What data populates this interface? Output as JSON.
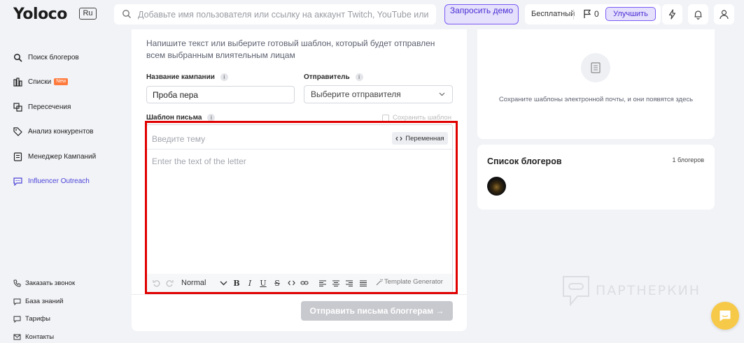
{
  "header": {
    "logo": "Yoloco",
    "lang": "Ru",
    "search_placeholder": "Добавьте имя пользователя или ссылку на аккаунт Twitch, YouTube или Instagram",
    "demo_label": "Запросить демо",
    "plan_label": "Бесплатный",
    "flag_count": "0",
    "upgrade_label": "Улучшить"
  },
  "sidebar": {
    "items": [
      {
        "label": "Поиск блогеров",
        "icon": "search-icon"
      },
      {
        "label": "Списки",
        "icon": "list-icon",
        "badge": "New"
      },
      {
        "label": "Пересечения",
        "icon": "intersection-icon"
      },
      {
        "label": "Анализ конкурентов",
        "icon": "tag-icon"
      },
      {
        "label": "Менеджер Кампаний",
        "icon": "campaign-icon"
      },
      {
        "label": "Influencer Outreach",
        "icon": "chat-icon",
        "active": true
      }
    ],
    "footer": [
      {
        "label": "Заказать звонок",
        "icon": "phone-icon"
      },
      {
        "label": "База знаний",
        "icon": "book-icon"
      },
      {
        "label": "Тарифы",
        "icon": "tariff-icon"
      },
      {
        "label": "Контакты",
        "icon": "contacts-icon"
      }
    ]
  },
  "form": {
    "intro": "Напишите текст или выберите готовый шаблон, который будет отправлен всем выбранным влиятельным лицам",
    "campaign_label": "Название кампании",
    "campaign_value": "Проба пера",
    "sender_label": "Отправитель",
    "sender_placeholder": "Выберите отправителя",
    "template_label": "Шаблон письма",
    "save_template_label": "Сохранить шаблон",
    "subject_placeholder": "Введите тему",
    "variable_label": "Переменная",
    "body_placeholder": "Enter the text of the letter",
    "format_value": "Normal",
    "template_generator_label": "Template Generator",
    "send_label": "Отправить письма блоггерам →"
  },
  "templates": {
    "empty_text": "Сохраните шаблоны электронной почты, и они появятся здесь"
  },
  "bloggers": {
    "title": "Список блогеров",
    "count": "1 блогеров"
  },
  "watermark": "ПАРТНЕРКИН",
  "colors": {
    "accent": "#4b43d8",
    "highlight": "#e00000",
    "chat": "#f7c948"
  }
}
